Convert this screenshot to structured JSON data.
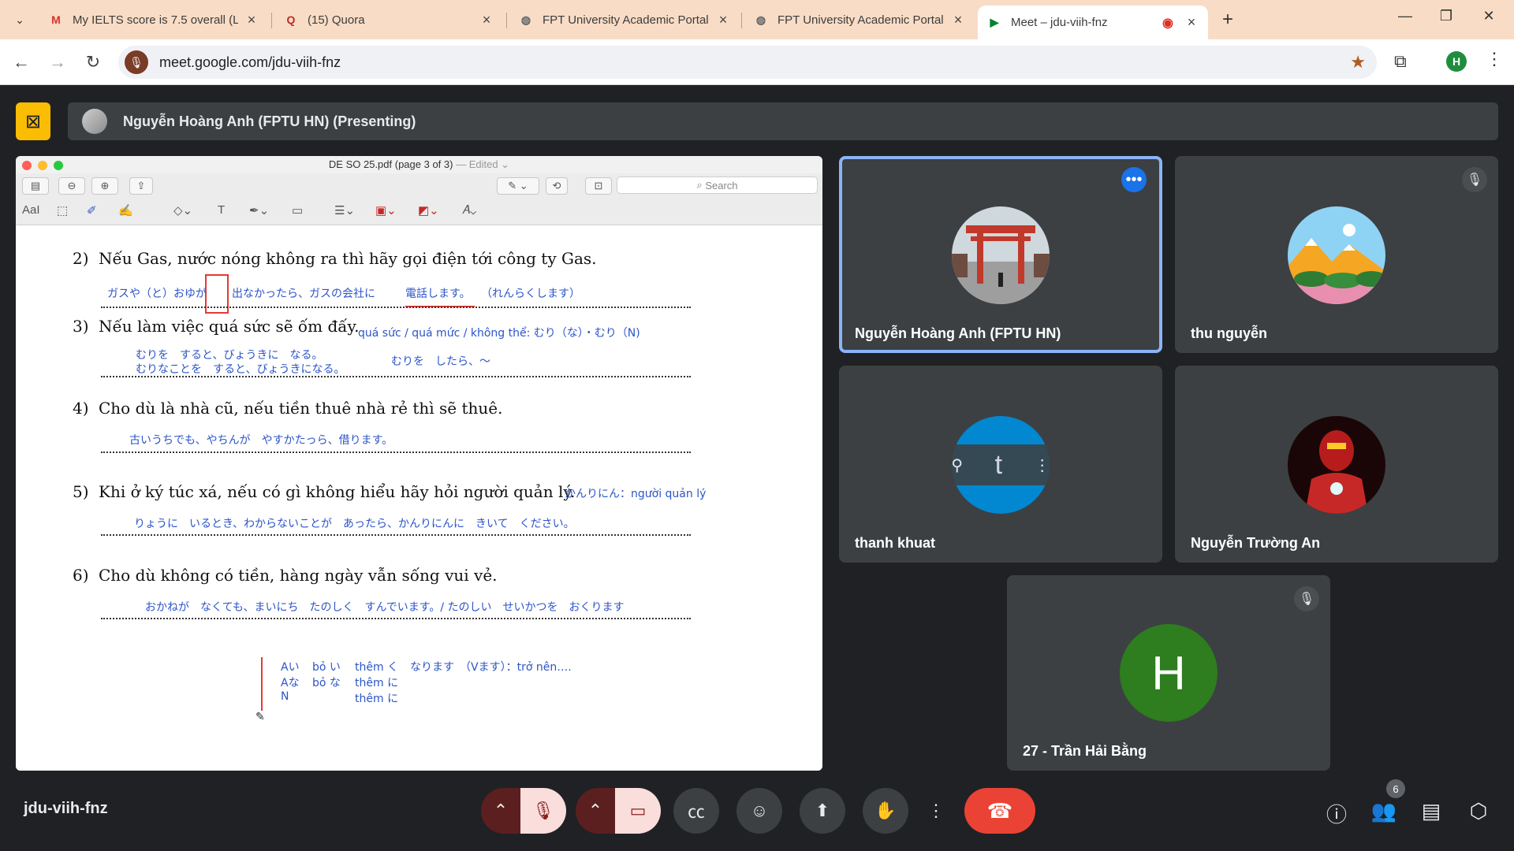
{
  "browser": {
    "tabs": [
      {
        "title": "My IELTS score is 7.5 overall (L",
        "icon": "gmail-icon"
      },
      {
        "title": "(15) Quora",
        "icon": "quora-icon"
      },
      {
        "title": "FPT University Academic Portal",
        "icon": "globe-icon"
      },
      {
        "title": "FPT University Academic Portal",
        "icon": "globe-icon"
      },
      {
        "title": "Meet – jdu-viih-fnz",
        "icon": "meet-icon",
        "active": true
      }
    ],
    "url": "meet.google.com/jdu-viih-fnz",
    "profile_initial": "H"
  },
  "meet": {
    "presenter_label": "Nguyễn Hoàng Anh (FPTU HN) (Presenting)",
    "meeting_code": "jdu-viih-fnz",
    "participant_count": "6",
    "participants": [
      {
        "name": "Nguyễn Hoàng Anh (FPTU HN)",
        "speaking": true
      },
      {
        "name": "thu nguyễn",
        "muted": true
      },
      {
        "name": "thanh khuat"
      },
      {
        "name": "Nguyễn Trường An"
      },
      {
        "name": "27 - Trần Hải Bằng",
        "initial": "H",
        "muted": true,
        "avatar_color": "#2e7d1f"
      }
    ]
  },
  "preview": {
    "window_title": "DE SO 25.pdf (page 3 of 3)",
    "edited_label": "— Edited ⌄",
    "search_placeholder": "Search",
    "text_tool": "AaI"
  },
  "document": {
    "questions": [
      {
        "num": "2)",
        "text": "Nếu Gas, nước nóng không ra thì hãy gọi điện tới công ty Gas."
      },
      {
        "num": "3)",
        "text": "Nếu làm việc quá sức sẽ ốm đấy."
      },
      {
        "num": "4)",
        "text": "Cho dù là nhà cũ, nếu tiền thuê nhà rẻ thì sẽ thuê."
      },
      {
        "num": "5)",
        "text": "Khi ở ký túc xá, nếu có gì không hiểu hãy hỏi người quản lý."
      },
      {
        "num": "6)",
        "text": "Cho dù không có tiền, hàng ngày vẫn sống vui vẻ."
      }
    ],
    "notes": {
      "q2_answer_a": "ガスや（と）おゆが",
      "q2_answer_b": "出なかったら、ガスの会社に",
      "q2_answer_c": "電話します。",
      "q2_answer_d": "（れんらくします）",
      "q3_vocab": "quá sức / quá mức / không thể: むり（な）・むり（N)",
      "q3_line1": "むりを　すると、びょうきに　なる。",
      "q3_line2": "むりなことを　すると、びょうきになる。",
      "q3_line3": "むりを　したら、～",
      "q4_answer": "古いうちでも、やちんが　やすかたっら、借ります。",
      "q5_vocab": "かんりにん：người quản lý",
      "q5_answer": "りょうに　いるとき、わからないことが　あったら、かんりにんに　きいて　ください。",
      "q6_answer": "おかねが　なくても、まいにち　たのしく　すんでいます。/ たのしい　せいかつを　おくります",
      "grammar_r1_a": "Aい",
      "grammar_r1_b": "bỏ い",
      "grammar_r1_c": "thêm く",
      "grammar_r1_d": "なります　（Vます）：trở nên….",
      "grammar_r2_a": "Aな",
      "grammar_r2_b": "bỏ な",
      "grammar_r2_c": "thêm に",
      "grammar_r3_a": "N",
      "grammar_r3_c": "thêm に"
    }
  },
  "colors": {
    "meet_background": "#202124",
    "tile": "#3c4043",
    "active_border": "#8ab4f8",
    "leave": "#ea4335",
    "annotation_blue": "#2c55c9",
    "annotation_red": "#e53935",
    "tabstrip": "#f9dcc5"
  }
}
